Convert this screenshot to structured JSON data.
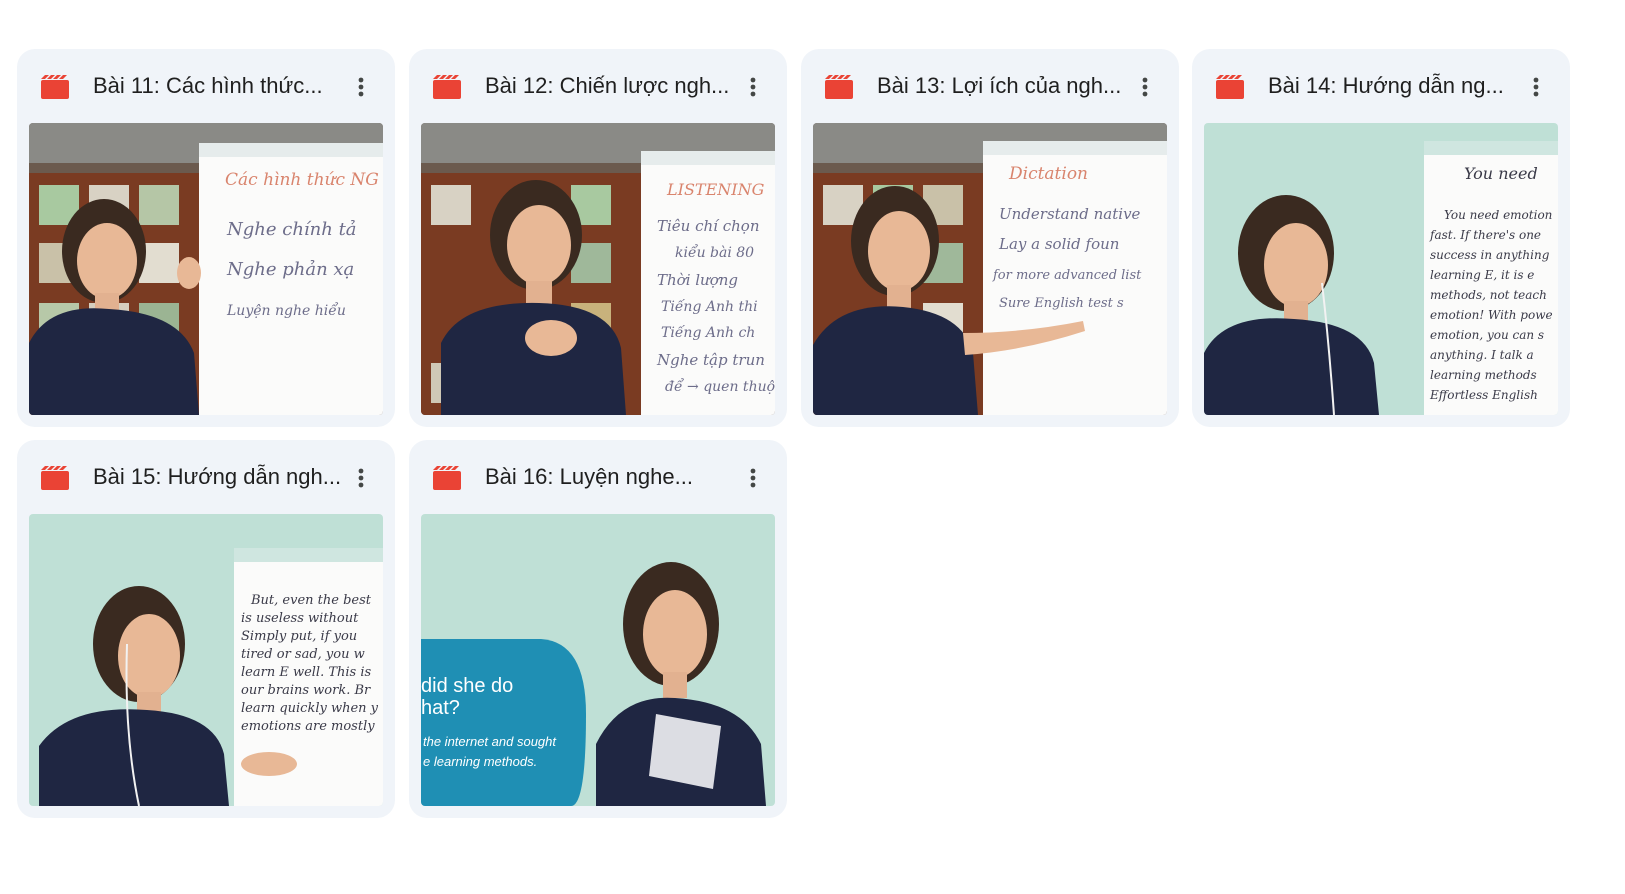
{
  "colors": {
    "card_bg": "#f0f4f9",
    "video_icon": "#ea4335",
    "title_text": "#1f1f1f",
    "more_icon": "#444746"
  },
  "cards": [
    {
      "title": "Bài 11: Các hình thức...",
      "icon": "video-file-icon",
      "board_lines": [
        "Các hình thức NG",
        "Nghe chính tả",
        "Nghe phản xạ",
        "Luyện nghe hiểu"
      ]
    },
    {
      "title": "Bài 12: Chiến lược ngh...",
      "icon": "video-file-icon",
      "board_lines": [
        "LISTENING",
        "Tiêu chí chọn",
        "kiểu bài 80",
        "Thời lượng",
        "Tiếng Anh thi",
        "Tiếng Anh ch",
        "Nghe tập trun",
        "để → quen thuộ"
      ]
    },
    {
      "title": "Bài 13: Lợi ích của ngh...",
      "icon": "video-file-icon",
      "board_lines": [
        "Dictation",
        "Understand native",
        "Lay a solid foun",
        "for more advanced list",
        "Sure English test s"
      ]
    },
    {
      "title": "Bài 14: Hướng dẫn ng...",
      "icon": "video-file-icon",
      "board_lines": [
        "You need",
        "You need emotion",
        "fast. If there's one",
        "success in anything",
        "learning E, it is e",
        "methods, not teach",
        "emotion! With powe",
        "emotion, you can s",
        "anything. I talk a",
        "learning methods",
        "Effortless English"
      ]
    },
    {
      "title": "Bài 15: Hướng dẫn ngh...",
      "icon": "video-file-icon",
      "board_lines": [
        "But, even the best",
        "is useless without",
        "Simply put, if you",
        "tired or sad, you w",
        "learn E well. This is",
        "our brains work. Br",
        "learn quickly when y",
        "emotions are mostly"
      ]
    },
    {
      "title": "Bài 16: Luyện nghe...",
      "icon": "video-file-icon",
      "caption_heading": "did she do\nhat?",
      "caption_body": "the internet and sought\ne learning methods."
    }
  ]
}
